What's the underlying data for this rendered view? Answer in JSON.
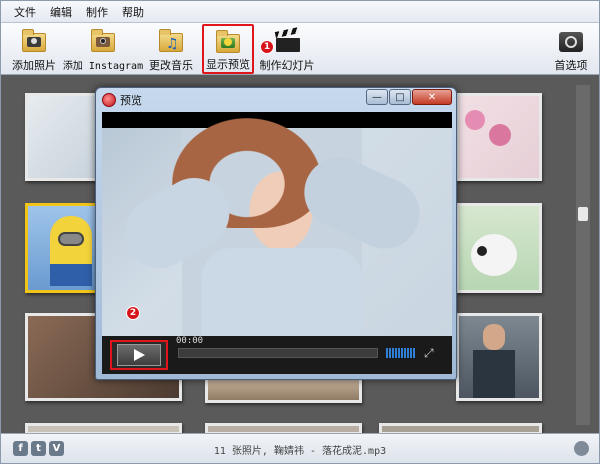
{
  "menu": [
    "文件",
    "编辑",
    "制作",
    "帮助"
  ],
  "toolbar": {
    "add_photos": "添加照片",
    "add_instagram": "添加 Instagram",
    "change_music": "更改音乐",
    "show_preview": "显示预览",
    "make_slideshow": "制作幻灯片",
    "preferences": "首选项"
  },
  "annotations": {
    "step1": "1",
    "step2": "2"
  },
  "preview_window": {
    "title": "预览",
    "time": "00:00",
    "minimize": "—",
    "maximize": "□",
    "close": "✕"
  },
  "status": {
    "text": "11 张照片, 鞠婧祎 - 落花成泥.mp3"
  },
  "social": {
    "facebook": "f",
    "twitter": "t",
    "vimeo": "V"
  },
  "colors": {
    "highlight": "#e0161b",
    "selected_border": "#f0c419",
    "background": "#5a5a5a"
  }
}
